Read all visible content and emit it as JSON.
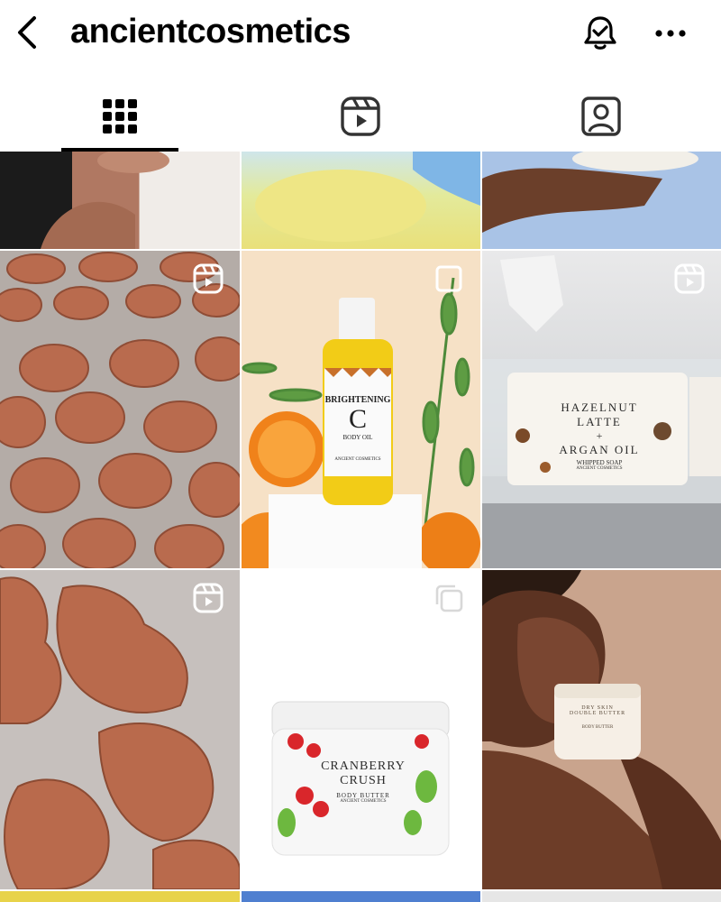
{
  "header": {
    "username": "ancientcosmetics",
    "back_icon": "chevron-left-icon",
    "notification_icon": "bell-check-icon",
    "more_icon": "ellipsis-icon"
  },
  "tabs": [
    {
      "name": "posts-grid",
      "icon": "grid-icon",
      "active": true
    },
    {
      "name": "reels",
      "icon": "reels-icon",
      "active": false
    },
    {
      "name": "tagged",
      "icon": "tagged-person-icon",
      "active": false
    }
  ],
  "posts": {
    "row1_center": {
      "title": "BRIGHTENING",
      "letter": "C",
      "subtitle": "BODY OIL",
      "brand": "ANCIENT COSMETICS"
    },
    "row1_right": {
      "line1": "HAZELNUT",
      "line2": "LATTE",
      "plus": "+",
      "line3": "ARGAN OIL",
      "subtitle": "WHIPPED SOAP",
      "brand": "ANCIENT COSMETICS"
    },
    "row2_center": {
      "line1": "CRANBERRY",
      "line2": "CRUSH",
      "subtitle": "BODY BUTTER",
      "brand": "ANCIENT COSMETICS"
    },
    "row2_right": {
      "line1": "DRY SKIN",
      "line2": "DOUBLE BUTTER",
      "subtitle": "BODY BUTTER"
    }
  },
  "colors": {
    "accent": "#000000",
    "background": "#ffffff",
    "soap": "#b8684c"
  }
}
